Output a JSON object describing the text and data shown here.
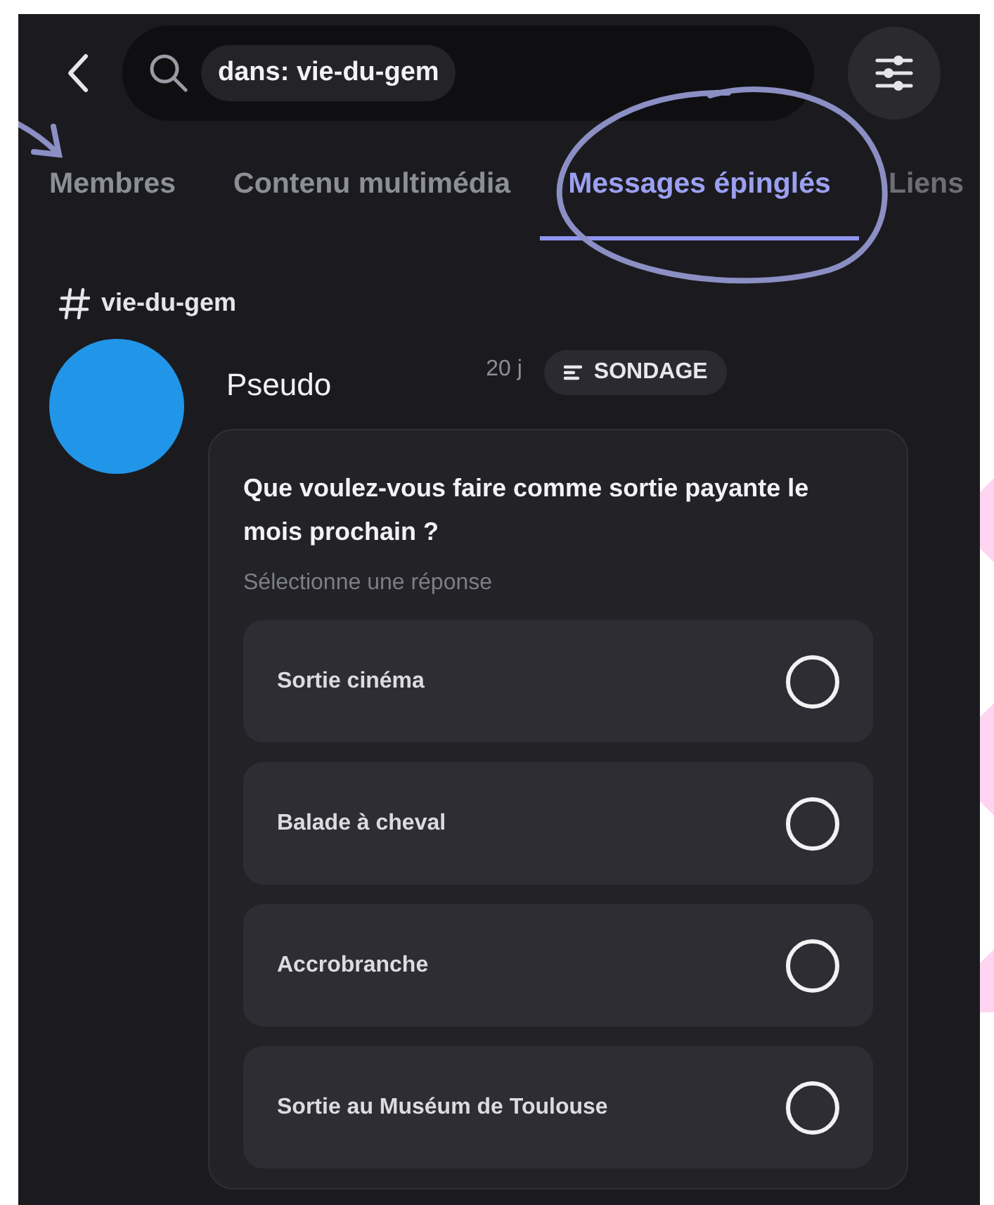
{
  "search": {
    "chip": "dans: vie-du-gem"
  },
  "tabs": [
    {
      "label": "Membres",
      "selected": false
    },
    {
      "label": "Contenu multimédia",
      "selected": false
    },
    {
      "label": "Messages épinglés",
      "selected": true
    },
    {
      "label": "Liens",
      "selected": false
    }
  ],
  "channel": "vie-du-gem",
  "message": {
    "author": "Pseudo",
    "time": "20 j",
    "badge": "SONDAGE",
    "poll": {
      "question": "Que voulez-vous faire comme sortie payante le mois prochain ?",
      "hint": "Sélectionne une réponse",
      "options": [
        {
          "label": "Sortie cinéma",
          "selected": false
        },
        {
          "label": "Balade à cheval",
          "selected": false
        },
        {
          "label": "Accrobranche",
          "selected": false
        },
        {
          "label": "Sortie au Muséum de Toulouse",
          "selected": false
        }
      ]
    }
  }
}
